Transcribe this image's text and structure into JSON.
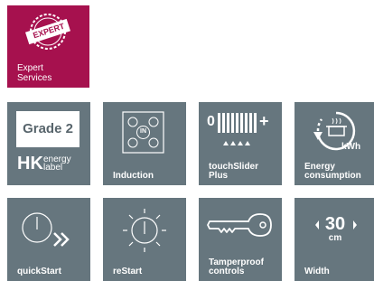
{
  "expert": {
    "badge_text": "EXPERT",
    "label_line1": "Expert",
    "label_line2": "Services"
  },
  "tiles": {
    "grade": {
      "grade_text": "Grade 2",
      "hk": "HK",
      "energy_line1": "energy",
      "energy_line2": "label"
    },
    "induction": {
      "center_text": "IN",
      "label": "Induction"
    },
    "touchslider": {
      "label_line1": "touchSlider",
      "label_line2": "Plus",
      "left_digit": "0",
      "plus": "+"
    },
    "energy": {
      "unit": "kWh",
      "label_line1": "Energy",
      "label_line2": "consumption"
    },
    "quickstart": {
      "label": "quickStart"
    },
    "restart": {
      "label": "reStart"
    },
    "tamperproof": {
      "label_line1": "Tamperproof",
      "label_line2": "controls"
    },
    "width": {
      "value": "30",
      "unit": "cm",
      "label": "Width"
    }
  },
  "colors": {
    "tile_bg": "#66767e",
    "expert_bg": "#a6114e",
    "text": "#ffffff"
  }
}
